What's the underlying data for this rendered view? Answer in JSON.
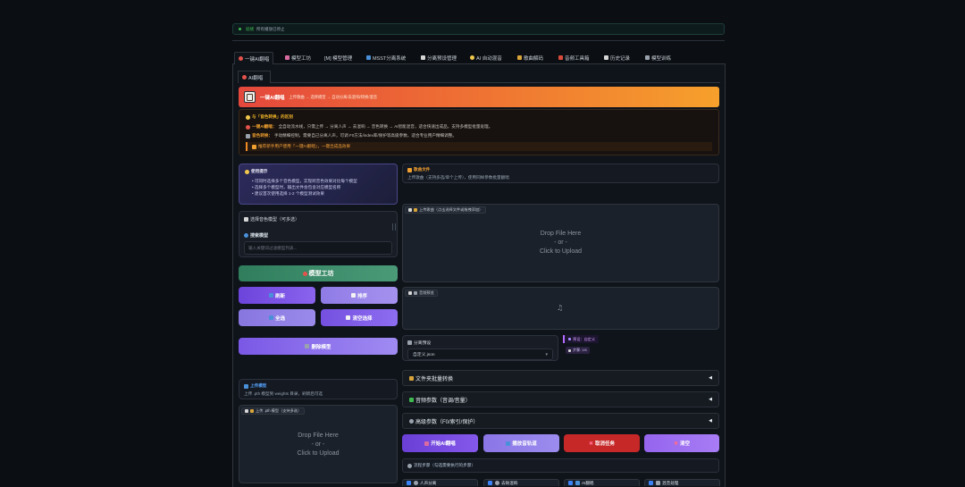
{
  "status_bar": {
    "label": "就绪",
    "message": "所有播放已停止"
  },
  "tabs": [
    {
      "label": "一键AI翻唱",
      "icon": "target-icon"
    },
    {
      "label": "模型工坊",
      "icon": "mixer-icon"
    },
    {
      "label": "[M] 模型管理"
    },
    {
      "label": "MSST分离系统",
      "icon": "grid-icon"
    },
    {
      "label": "分离预设管理",
      "icon": "clipboard-icon"
    },
    {
      "label": "AI 自动混音",
      "icon": "sparkle-icon"
    },
    {
      "label": "歌曲解码",
      "icon": "lock-icon"
    },
    {
      "label": "音频工具箱",
      "icon": "toolbox-icon"
    },
    {
      "label": "历史记录",
      "icon": "clipboard-icon"
    },
    {
      "label": "模型训练",
      "icon": "wrench-icon"
    }
  ],
  "subtab": {
    "label": "AI翻唱"
  },
  "banner": {
    "title": "一键AI翻唱",
    "subtitle": "上传歌曲 → 选择模型 → 自动分离/去混响/转换/混音"
  },
  "info": {
    "heading": "与「音色转换」的区别",
    "line1_label": "一键AI翻唱：",
    "line1_text": "全自动流水线，只需上传 → 分离人声 → 去混响 → 音色转换 → AI智能混音，适合快速出成品，支持多模型批量处理。",
    "line2_label": "音色转换：",
    "line2_text": "手动精细控制，需要自己分离人声，可调 F0方法/index率/保护等高级参数，适合专业用户精细调整。",
    "tip": "推荐新手用户使用「一键AI翻唱」，一键出成品效果"
  },
  "tips": {
    "title": "使用提示",
    "items": [
      "• 可同时选择多个音色模型，实现跨音色效果对比每个模型",
      "• 选择多个模型时，输出文件会包含对应模型名称",
      "• 建议首次使用选择 1-2 个模型测试效果"
    ]
  },
  "model_select": {
    "title": "选择音色模型（可多选）",
    "search_label": "搜索模型",
    "search_placeholder": "输入关键词过滤模型列表..."
  },
  "workshop_button": "模型工坊",
  "model_buttons": {
    "refresh": "刷新",
    "sort": "排序",
    "select_all": "全选",
    "clear_selection": "清空选择",
    "delete": "删除模型"
  },
  "upload_model": {
    "title": "上传模型",
    "desc": "上传 .pth 模型到 weights 目录，刷新后可选"
  },
  "model_dropzone": {
    "label": "上传 .pth 模型（支持多选）",
    "drop": "Drop File Here",
    "or": "- or -",
    "click": "Click to Upload"
  },
  "song": {
    "title": "歌曲文件",
    "desc": "上传歌曲（支持多选/单个上传），使用同样参数批量翻唱"
  },
  "song_dropzone": {
    "label": "上传歌曲（点击选择文件或拖拽添加）",
    "drop": "Drop File Here",
    "or": "- or -",
    "click": "Click to Upload"
  },
  "audio_preview": {
    "label": "音频预览"
  },
  "preset": {
    "label": "分离预设",
    "value": "自定义.json",
    "badge": "预设：自定义",
    "step": "步骤: 2/6"
  },
  "accordions": [
    "文件夹批量转换",
    "音频参数（音调/音量）",
    "高级参数（F0/索引/保护）"
  ],
  "actions": {
    "start": "开始AI翻唱",
    "preview": "播放音轨道",
    "cancel": "取消任务",
    "clear": "清空"
  },
  "steps": {
    "title": "流程步骤（勾选需要执行的步骤）",
    "items": [
      {
        "label": "人声分离",
        "checked": true
      },
      {
        "label": "去除混响",
        "checked": true
      },
      {
        "label": "AI翻唱",
        "checked": true
      },
      {
        "label": "混音处理",
        "checked": true
      }
    ]
  },
  "colors": {
    "accent": "#8a63ee",
    "danger": "#c62828",
    "success": "#3fb950",
    "banner_start": "#e4483c",
    "banner_end": "#f6a02c",
    "workshop": "#3f8c6a"
  }
}
